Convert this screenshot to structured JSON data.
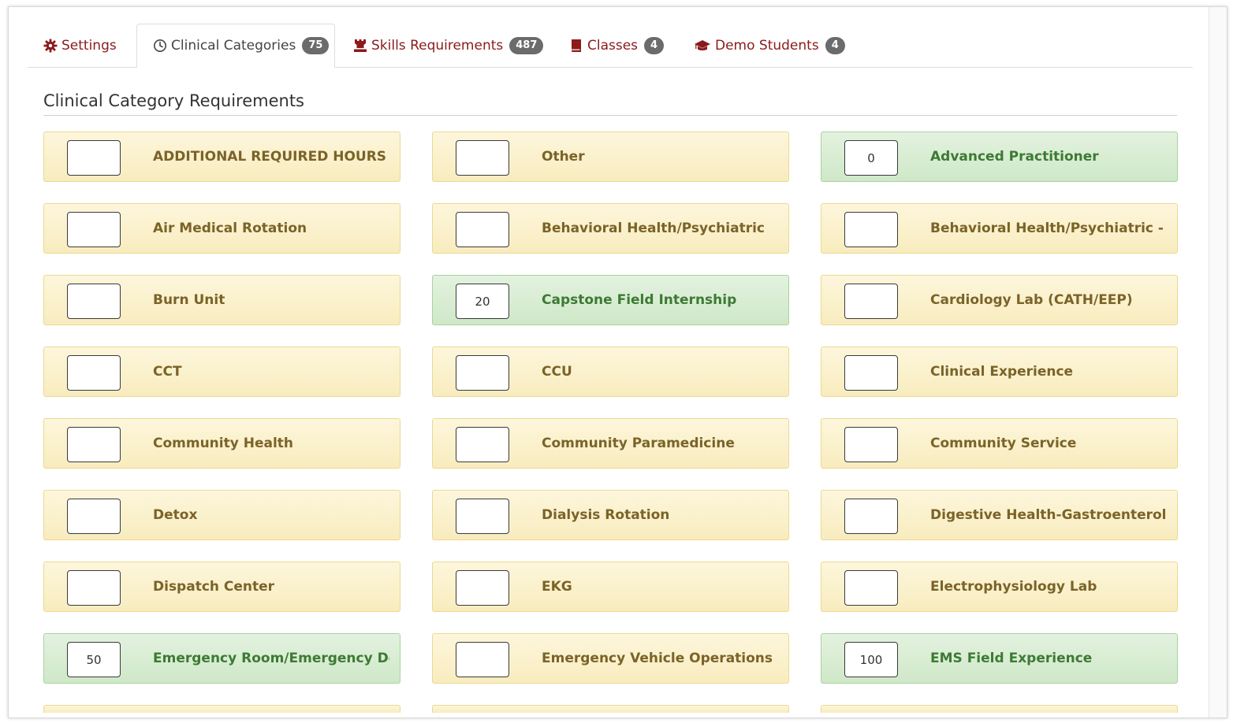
{
  "tabs": [
    {
      "label": "Settings",
      "icon": "gear-icon",
      "badge": null,
      "active": false
    },
    {
      "label": "Clinical Categories",
      "icon": "clock-icon",
      "badge": "75",
      "active": true
    },
    {
      "label": "Skills Requirements",
      "icon": "chess-rook-icon",
      "badge": "487",
      "active": false
    },
    {
      "label": "Classes",
      "icon": "book-icon",
      "badge": "4",
      "active": false
    },
    {
      "label": "Demo Students",
      "icon": "graduation-cap-icon",
      "badge": "4",
      "active": false
    }
  ],
  "section": {
    "title": "Clinical Category Requirements"
  },
  "categories": [
    {
      "label": "ADDITIONAL REQUIRED HOURS",
      "value": ""
    },
    {
      "label": "Other",
      "value": ""
    },
    {
      "label": "Advanced Practitioner",
      "value": "0"
    },
    {
      "label": "Air Medical Rotation",
      "value": ""
    },
    {
      "label": "Behavioral Health/Psychiatric",
      "value": ""
    },
    {
      "label": "Behavioral Health/Psychiatric - ...",
      "value": ""
    },
    {
      "label": "Burn Unit",
      "value": ""
    },
    {
      "label": "Capstone Field Internship",
      "value": "20"
    },
    {
      "label": "Cardiology Lab (CATH/EEP)",
      "value": ""
    },
    {
      "label": "CCT",
      "value": ""
    },
    {
      "label": "CCU",
      "value": ""
    },
    {
      "label": "Clinical Experience",
      "value": ""
    },
    {
      "label": "Community Health",
      "value": ""
    },
    {
      "label": "Community Paramedicine",
      "value": ""
    },
    {
      "label": "Community Service",
      "value": ""
    },
    {
      "label": "Detox",
      "value": ""
    },
    {
      "label": "Dialysis Rotation",
      "value": ""
    },
    {
      "label": "Digestive Health-Gastroenterolo...",
      "value": ""
    },
    {
      "label": "Dispatch Center",
      "value": ""
    },
    {
      "label": "EKG",
      "value": ""
    },
    {
      "label": "Electrophysiology Lab",
      "value": ""
    },
    {
      "label": "Emergency Room/Emergency De...",
      "value": "50"
    },
    {
      "label": "Emergency Vehicle Operations",
      "value": ""
    },
    {
      "label": "EMS Field Experience",
      "value": "100"
    }
  ],
  "colors": {
    "tab_link": "#8b1a1a",
    "pending_bg": "#f8ecbe",
    "pending_text": "#7b6328",
    "done_bg": "#cfe8c8",
    "done_text": "#3d7a34",
    "badge_bg": "#6b6b6b"
  }
}
